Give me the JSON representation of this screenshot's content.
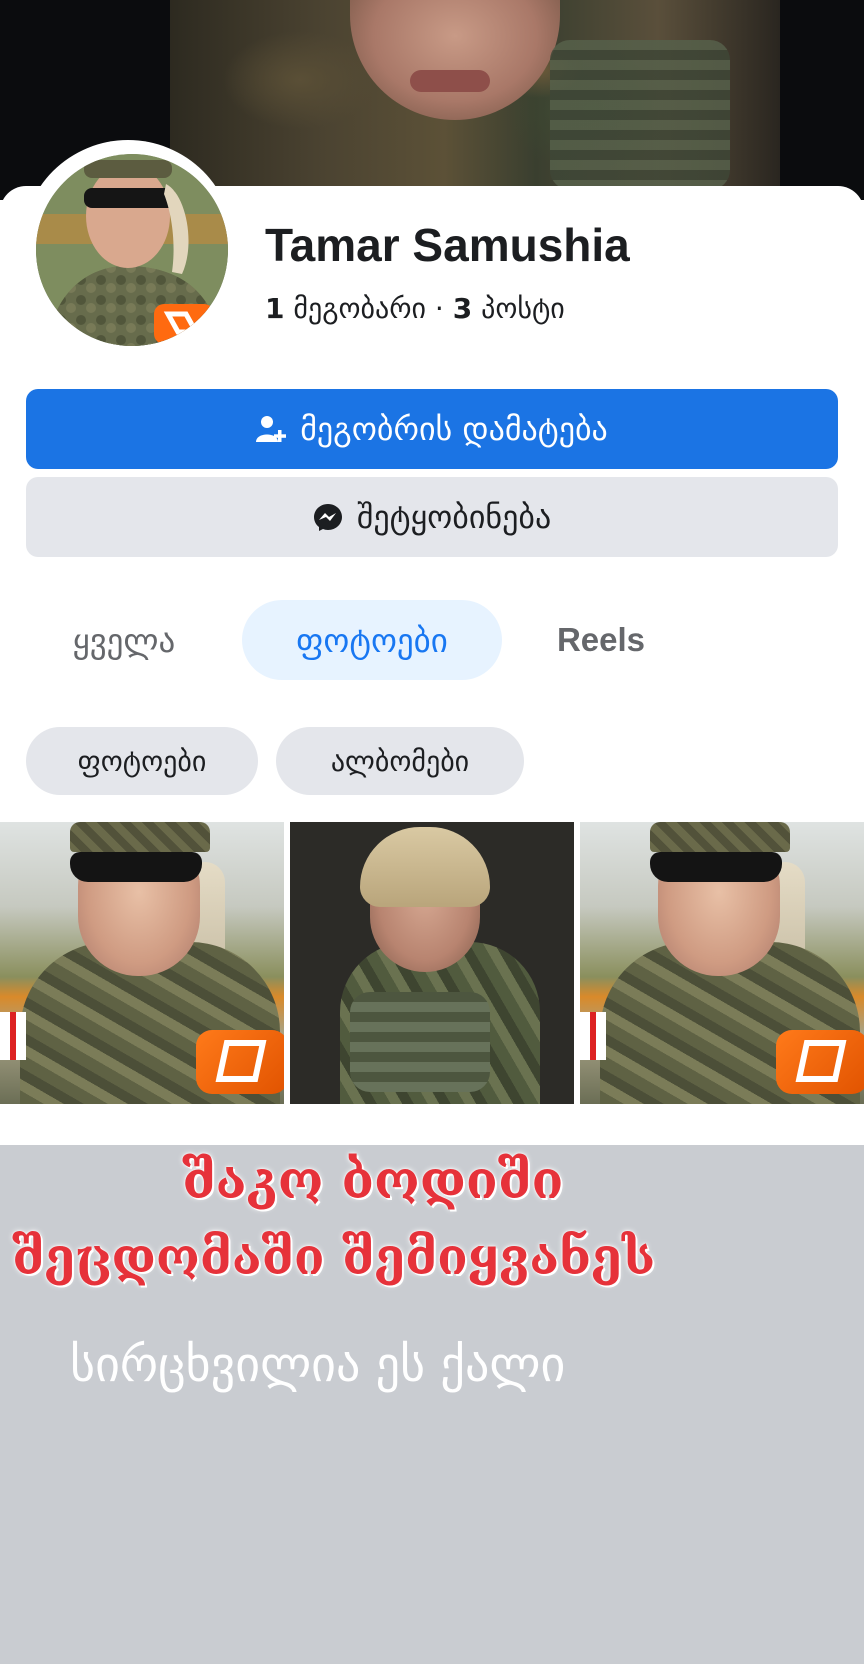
{
  "profile": {
    "name": "Tamar Samushia",
    "friends_count": "1",
    "friends_label": "მეგობარი",
    "separator": "·",
    "posts_count": "3",
    "posts_label": "პოსტი"
  },
  "actions": {
    "add_friend_label": "მეგობრის დამატება",
    "add_friend_icon": "add-friend-icon",
    "message_label": "შეტყობინება",
    "message_icon": "messenger-icon"
  },
  "tabs": [
    {
      "label": "ყველა",
      "active": false
    },
    {
      "label": "ფოტოები",
      "active": true
    },
    {
      "label": "Reels",
      "active": false
    }
  ],
  "subtabs": [
    {
      "label": "ფოტოები"
    },
    {
      "label": "ალბომები"
    }
  ],
  "colors": {
    "primary_button": "#1b74e4",
    "secondary_button": "#e4e6eb",
    "active_tab_bg": "#e7f3ff",
    "active_tab_text": "#1877f2",
    "caption_red": "#e6323a",
    "overlay_gray": "#c9ccd1"
  },
  "caption": {
    "line1": "შაკო ბოდიში",
    "line2": "შეცდომაში შემიყვანეს",
    "line3": "სირცხვილია ეს ქალი"
  }
}
